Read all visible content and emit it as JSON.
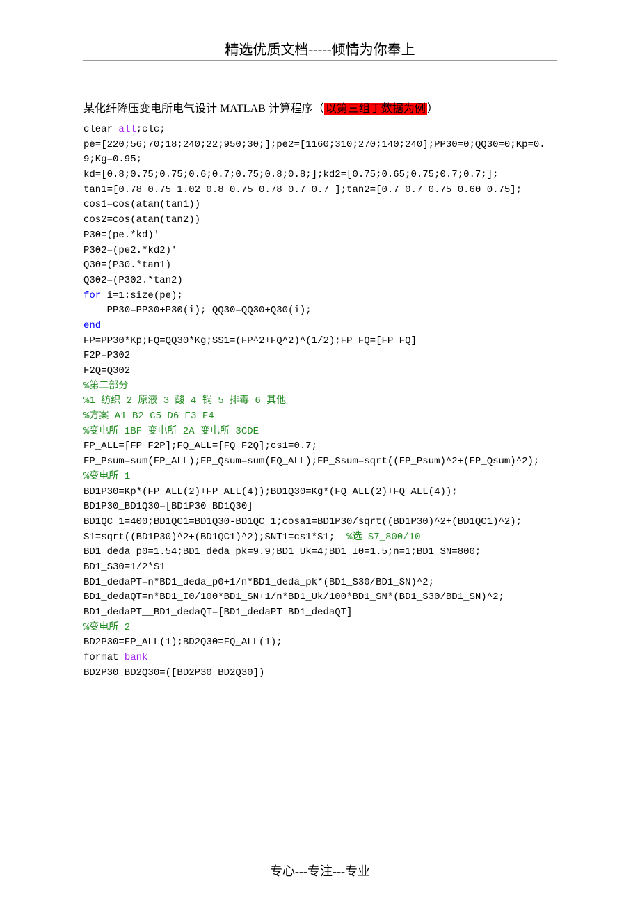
{
  "header": {
    "title": "精选优质文档-----倾情为你奉上"
  },
  "doc_title": {
    "prefix": "某化纤降压变电所电气设计 ",
    "latin": "MATLAB",
    "mid": " 计算程序（",
    "highlight": "以第三组丁数据为例",
    "suffix": "）"
  },
  "code": {
    "l01a": "clear ",
    "l01b": "all",
    "l01c": ";clc;",
    "l02": "pe=[220;56;70;18;240;22;950;30;];pe2=[1160;310;270;140;240];PP30=0;QQ30=0;Kp=0.9;Kg=0.95;",
    "l03": "kd=[0.8;0.75;0.75;0.6;0.7;0.75;0.8;0.8;];kd2=[0.75;0.65;0.75;0.7;0.7;];",
    "l04": "tan1=[0.78 0.75 1.02 0.8 0.75 0.78 0.7 0.7 ];tan2=[0.7 0.7 0.75 0.60 0.75];",
    "l05": "cos1=cos(atan(tan1))",
    "l06": "cos2=cos(atan(tan2))",
    "l07": "P30=(pe.*kd)'",
    "l08": "P302=(pe2.*kd2)'",
    "l09": "Q30=(P30.*tan1)",
    "l10": "Q302=(P302.*tan2)",
    "l11a": "for",
    "l11b": " i=1:size(pe);",
    "l12": "    PP30=PP30+P30(i); QQ30=QQ30+Q30(i);",
    "l13": "end",
    "l14": "FP=PP30*Kp;FQ=QQ30*Kg;SS1=(FP^2+FQ^2)^(1/2);FP_FQ=[FP FQ]",
    "l15": "F2P=P302",
    "l16": "F2Q=Q302",
    "c17": "%第二部分",
    "c18": "%1 纺织 2 原液 3 酸 4 锅 5 排毒 6 其他",
    "c19": "%方案 A1 B2 C5 D6 E3 F4",
    "c20": "%变电所 1BF 变电所 2A 变电所 3CDE",
    "l21": "FP_ALL=[FP F2P];FQ_ALL=[FQ F2Q];cs1=0.7;",
    "l22": "FP_Psum=sum(FP_ALL);FP_Qsum=sum(FQ_ALL);FP_Ssum=sqrt((FP_Psum)^2+(FP_Qsum)^2);",
    "c23": "%变电所 1",
    "l24": "BD1P30=Kp*(FP_ALL(2)+FP_ALL(4));BD1Q30=Kg*(FQ_ALL(2)+FQ_ALL(4));",
    "l25": "BD1P30_BD1Q30=[BD1P30 BD1Q30]",
    "l26": "BD1QC_1=400;BD1QC1=BD1Q30-BD1QC_1;cosa1=BD1P30/sqrt((BD1P30)^2+(BD1QC1)^2);",
    "l27a": "S1=sqrt((BD1P30)^2+(BD1QC1)^2);SNT1=cs1*S1;  ",
    "c27b": "%选 S7_800/10",
    "l28": "BD1_deda_p0=1.54;BD1_deda_pk=9.9;BD1_Uk=4;BD1_I0=1.5;n=1;BD1_SN=800;",
    "l29": "BD1_S30=1/2*S1",
    "l30": "BD1_dedaPT=n*BD1_deda_p0+1/n*BD1_deda_pk*(BD1_S30/BD1_SN)^2;",
    "l31": "BD1_dedaQT=n*BD1_I0/100*BD1_SN+1/n*BD1_Uk/100*BD1_SN*(BD1_S30/BD1_SN)^2;",
    "l32": "BD1_dedaPT__BD1_dedaQT=[BD1_dedaPT BD1_dedaQT]",
    "c33": "%变电所 2",
    "l34": "BD2P30=FP_ALL(1);BD2Q30=FQ_ALL(1);",
    "l35a": "format ",
    "l35b": "bank",
    "l36": "BD2P30_BD2Q30=([BD2P30 BD2Q30])"
  },
  "footer": {
    "text": "专心---专注---专业"
  }
}
